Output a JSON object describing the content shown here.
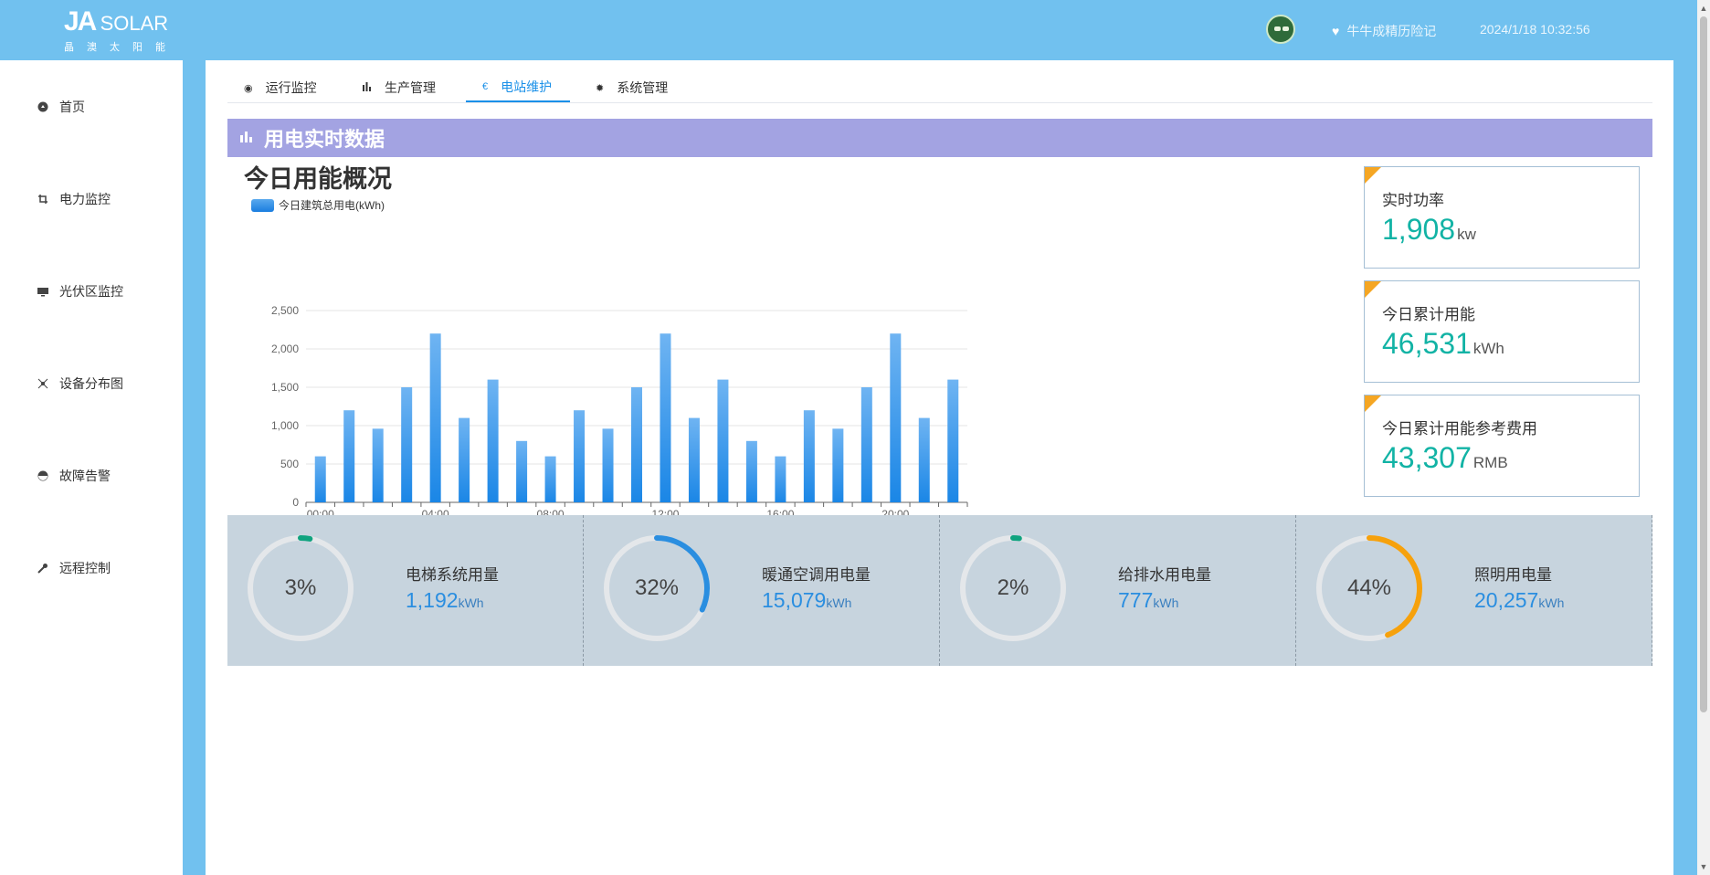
{
  "header": {
    "logo_main": "JA",
    "logo_solar": "SOLAR",
    "logo_sub": "晶澳太阳能",
    "user_icon": "heart-icon",
    "user_name": "牛牛成精历险记",
    "datetime": "2024/1/18 10:32:56"
  },
  "sidebar": {
    "items": [
      {
        "label": "首页",
        "icon": "home-icon"
      },
      {
        "label": "电力监控",
        "icon": "crop-icon"
      },
      {
        "label": "光伏区监控",
        "icon": "monitor-icon"
      },
      {
        "label": "设备分布图",
        "icon": "network-icon"
      },
      {
        "label": "故障告警",
        "icon": "alarm-icon"
      },
      {
        "label": "远程控制",
        "icon": "wrench-icon"
      }
    ]
  },
  "tabs": [
    {
      "label": "运行监控",
      "icon": "eye-icon"
    },
    {
      "label": "生产管理",
      "icon": "bar-chart-icon"
    },
    {
      "label": "电站维护",
      "icon": "euro-icon",
      "active": true
    },
    {
      "label": "系统管理",
      "icon": "gear-icon"
    }
  ],
  "section": {
    "title": "用电实时数据"
  },
  "chart_title": "今日用能概况",
  "chart_data": {
    "type": "bar",
    "series": [
      {
        "name": "今日建筑总用电(kWh)",
        "values": [
          600,
          1200,
          960,
          1500,
          2200,
          1100,
          1600,
          800,
          600,
          1200,
          960,
          1500,
          2200,
          1100,
          1600,
          800,
          600,
          1200,
          960,
          1500,
          2200,
          1100,
          1600
        ]
      }
    ],
    "x_ticks": [
      "00:00",
      "04:00",
      "08:00",
      "12:00",
      "16:00",
      "20:00"
    ],
    "y_ticks": [
      "0",
      "500",
      "1,000",
      "1,500",
      "2,000",
      "2,500"
    ],
    "ylim": [
      0,
      2500
    ],
    "grid": true,
    "legend": "top-left",
    "color": "#1a86e6"
  },
  "kpis": [
    {
      "label": "实时功率",
      "value": "1,908",
      "unit": "kw"
    },
    {
      "label": "今日累计用能",
      "value": "46,531",
      "unit": "kWh"
    },
    {
      "label": "今日累计用能参考费用",
      "value": "43,307",
      "unit": "RMB"
    }
  ],
  "stats": [
    {
      "pct_text": "3%",
      "pct": 3,
      "label": "电梯系统用量",
      "value": "1,192",
      "unit": "kWh",
      "color": "#0fa37f"
    },
    {
      "pct_text": "32%",
      "pct": 32,
      "label": "暖通空调用电量",
      "value": "15,079",
      "unit": "kWh",
      "color": "#2a8ee0"
    },
    {
      "pct_text": "2%",
      "pct": 2,
      "label": "给排水用电量",
      "value": "777",
      "unit": "kWh",
      "color": "#0fa37f"
    },
    {
      "pct_text": "44%",
      "pct": 44,
      "label": "照明用电量",
      "value": "20,257",
      "unit": "kWh",
      "color": "#f6a10c"
    }
  ]
}
